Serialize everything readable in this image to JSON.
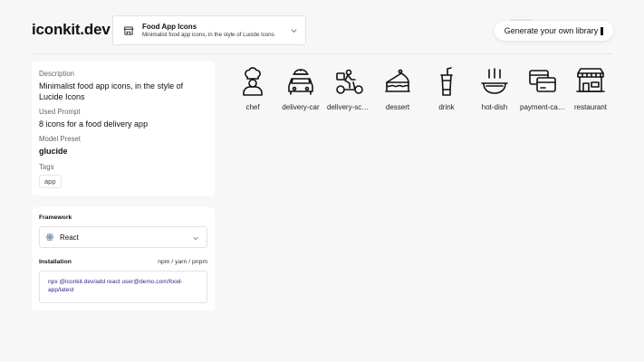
{
  "header": {
    "logo": "iconkit.dev",
    "library": {
      "title": "Food App Icons",
      "subtitle": "Minimalist food app icons, in the style of Lucide Icons"
    },
    "generate_button": "Generate your own library"
  },
  "info": {
    "description_label": "Description",
    "description": "Minimalist food app icons, in the style of Lucide Icons",
    "prompt_label": "Used Prompt",
    "prompt": "8 icons for a food delivery app",
    "preset_label": "Model Preset",
    "preset": "glucide",
    "tags_label": "Tags",
    "tags": [
      "app"
    ]
  },
  "framework": {
    "label": "Framework",
    "selected": "React",
    "installation_label": "Installation",
    "package_managers": "npm / yarn / pnpm",
    "command": "npx @iconkit.dev/add react user@demo.com/food-app/latest"
  },
  "icons": [
    {
      "label": "chef",
      "icon": "chef-icon"
    },
    {
      "label": "delivery-car",
      "icon": "delivery-car-icon"
    },
    {
      "label": "delivery-scooter",
      "icon": "delivery-scooter-icon"
    },
    {
      "label": "dessert",
      "icon": "dessert-icon"
    },
    {
      "label": "drink",
      "icon": "drink-icon"
    },
    {
      "label": "hot-dish",
      "icon": "hot-dish-icon"
    },
    {
      "label": "payment-cards",
      "icon": "payment-icon"
    },
    {
      "label": "restaurant",
      "icon": "restaurant-icon"
    }
  ]
}
